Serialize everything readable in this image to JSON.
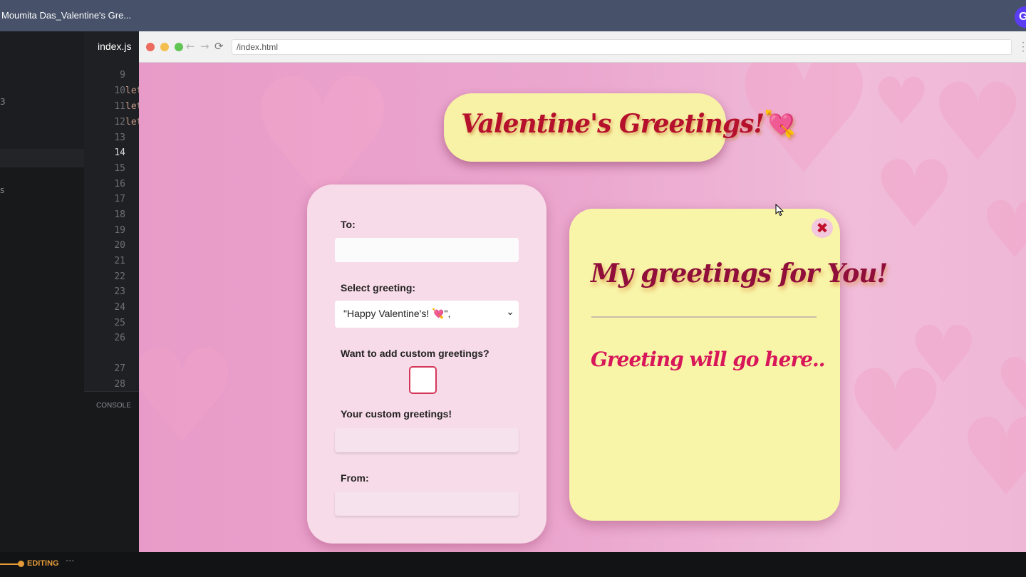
{
  "window": {
    "title": "Moumita Das_Valentine's Gre...",
    "avatar_letter": "G"
  },
  "sidebar": {
    "glyph_a": "3",
    "glyph_b": "s"
  },
  "editor": {
    "tab_label": "index.js",
    "line_numbers": [
      "9",
      "10",
      "11",
      "12",
      "13",
      "14",
      "15",
      "16",
      "17",
      "18",
      "19",
      "20",
      "21",
      "22",
      "23",
      "24",
      "25",
      "26",
      "27",
      "28"
    ],
    "code_fragments": [
      "let",
      "let",
      "let"
    ],
    "console_label": "CONSOLE"
  },
  "status": {
    "mode": "EDITING",
    "more": "···"
  },
  "browser": {
    "url": "/index.html"
  },
  "page": {
    "title": "Valentine's Greetings!",
    "title_emoji": "💘",
    "form": {
      "to_label": "To:",
      "to_value": "",
      "greeting_label": "Select greeting:",
      "greeting_selected": "\"Happy Valentine's! 💘\",",
      "custom_toggle_label": "Want to add custom greetings?",
      "custom_toggle_checked": false,
      "custom_label": "Your custom greetings!",
      "custom_value": "",
      "from_label": "From:",
      "from_value": ""
    },
    "note": {
      "close_symbol": "✖",
      "title": "My greetings for You!",
      "body": "Greeting will go here.."
    }
  },
  "colors": {
    "page_pink": "#e99fcb",
    "card_yellow": "#f8f4a8",
    "form_pink": "#f8dbe8",
    "title_red": "#b5102c",
    "note_title": "#8f0e3a",
    "note_body": "#d8165a",
    "status_accent": "#e59a38"
  }
}
